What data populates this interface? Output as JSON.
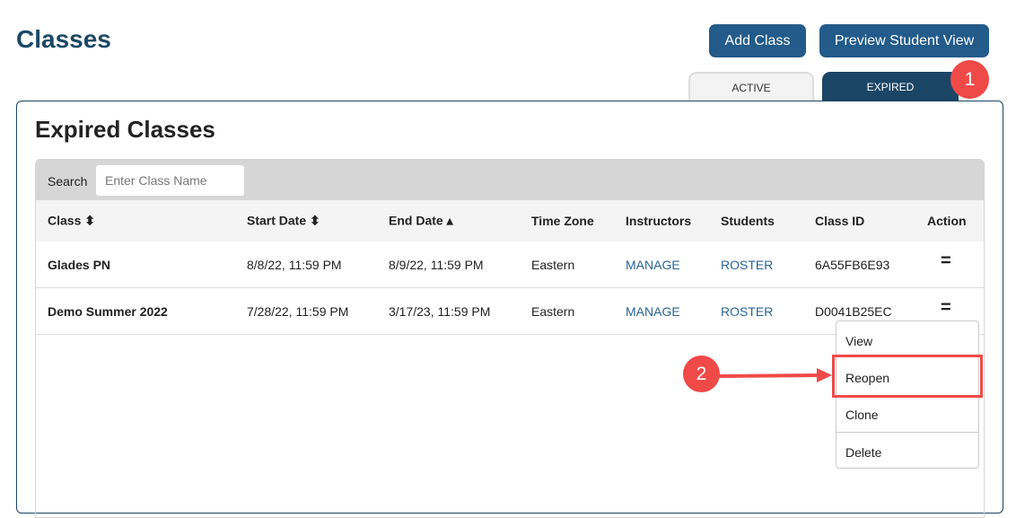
{
  "page_title": "Classes",
  "buttons": {
    "add_class": "Add Class",
    "preview": "Preview Student View"
  },
  "tabs": {
    "active": "ACTIVE",
    "expired": "EXPIRED"
  },
  "annotations": {
    "step1": "1",
    "step2": "2"
  },
  "panel_title": "Expired Classes",
  "search": {
    "label": "Search",
    "placeholder": "Enter Class Name"
  },
  "columns": [
    "Class ⬍",
    "Start Date ⬍",
    "End Date ▴",
    "Time Zone",
    "Instructors",
    "Students",
    "Class ID",
    "Action"
  ],
  "rows": [
    {
      "class": "Glades PN",
      "start": "8/8/22, 11:59 PM",
      "end": "8/9/22, 11:59 PM",
      "tz": "Eastern",
      "instructors": "MANAGE",
      "students": "ROSTER",
      "id": "6A55FB6E93"
    },
    {
      "class": "Demo Summer 2022",
      "start": "7/28/22, 11:59 PM",
      "end": "3/17/23, 11:59 PM",
      "tz": "Eastern",
      "instructors": "MANAGE",
      "students": "ROSTER",
      "id": "D0041B25EC"
    }
  ],
  "action_menu": [
    "View",
    "Reopen",
    "Clone",
    "Delete"
  ],
  "colors": {
    "primary": "#235b8a",
    "dark": "#1b4565",
    "annotation": "#f04a48"
  }
}
